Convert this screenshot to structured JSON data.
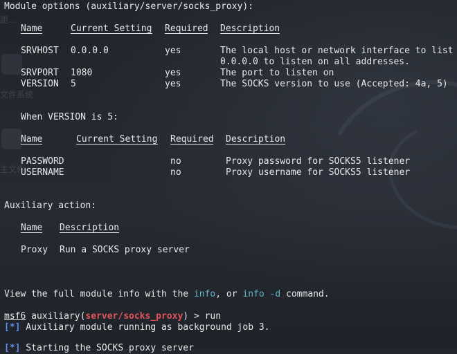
{
  "desktop": {
    "labels": [
      "距…",
      "文件系统",
      "主文件"
    ]
  },
  "module_options": {
    "header": "Module options (auxiliary/server/socks_proxy):",
    "columns": [
      "Name",
      "Current Setting",
      "Required",
      "Description"
    ],
    "rows": [
      {
        "name": "SRVHOST",
        "setting": "0.0.0.0",
        "required": "yes",
        "description": "The local host or network interface to list",
        "description2": "0.0.0.0 to listen on all addresses."
      },
      {
        "name": "SRVPORT",
        "setting": "1080",
        "required": "yes",
        "description": "The port to listen on"
      },
      {
        "name": "VERSION",
        "setting": "5",
        "required": "yes",
        "description": "The SOCKS version to use (Accepted: 4a, 5)"
      }
    ]
  },
  "version5": {
    "header": "When VERSION is 5:",
    "columns": [
      "Name",
      "Current Setting",
      "Required",
      "Description"
    ],
    "rows": [
      {
        "name": "PASSWORD",
        "setting": "",
        "required": "no",
        "description": "Proxy password for SOCKS5 listener"
      },
      {
        "name": "USERNAME",
        "setting": "",
        "required": "no",
        "description": "Proxy username for SOCKS5 listener"
      }
    ]
  },
  "auxiliary_action": {
    "header": "Auxiliary action:",
    "columns": [
      "Name",
      "Description"
    ],
    "rows": [
      {
        "name": "Proxy",
        "description": "Run a SOCKS proxy server"
      }
    ]
  },
  "info_line": {
    "pre": "View the full module info with the ",
    "cmd1": "info",
    "mid": ", or ",
    "cmd2": "info -d",
    "post": " command."
  },
  "prompt": {
    "console": "msf6",
    "context_pre": " auxiliary(",
    "module": "server/socks_proxy",
    "context_post": ") > ",
    "command": "run"
  },
  "output": [
    {
      "tag": "[*]",
      "text": " Auxiliary module running as background job 3."
    },
    {
      "tag": "[*]",
      "text": " Starting the SOCKS proxy server"
    }
  ],
  "colors": {
    "command_highlight": "#5fb7c6",
    "module_red": "#e2545a",
    "status_blue": "#5f8ff0",
    "text": "#e8e8e8"
  }
}
